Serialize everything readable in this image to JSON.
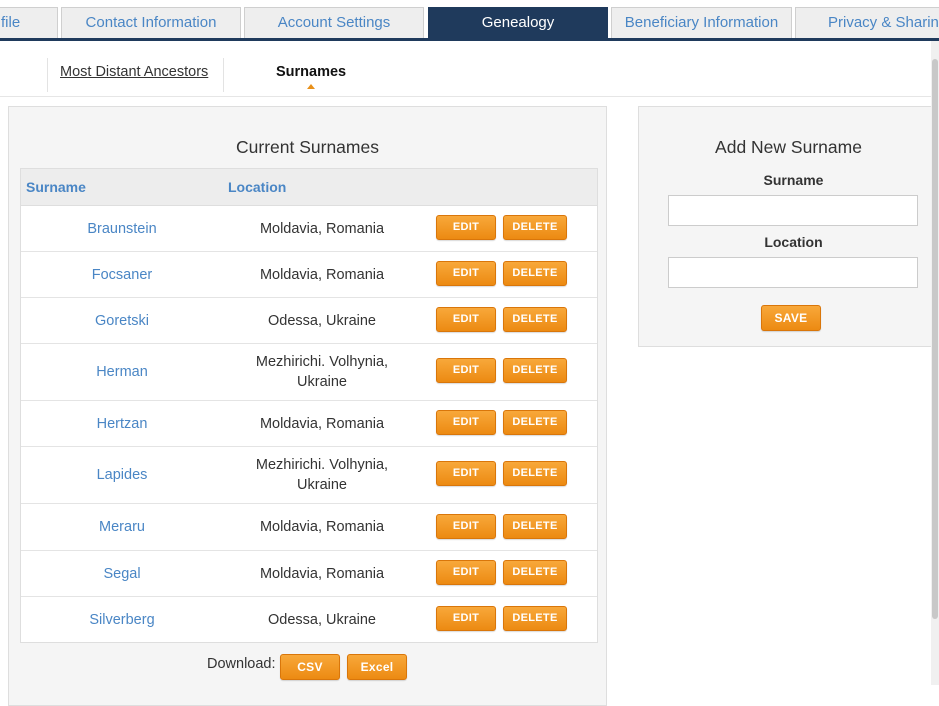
{
  "top_tabs": [
    {
      "label": "file"
    },
    {
      "label": "Contact Information"
    },
    {
      "label": "Account Settings"
    },
    {
      "label": "Genealogy"
    },
    {
      "label": "Beneficiary Information"
    },
    {
      "label": "Privacy & Sharin"
    }
  ],
  "sub_tabs": {
    "ancestors": "Most Distant Ancestors",
    "surnames": "Surnames"
  },
  "surnames_panel": {
    "title": "Current Surnames",
    "columns": {
      "surname": "Surname",
      "location": "Location"
    },
    "edit_label": "EDIT",
    "delete_label": "DELETE",
    "rows": [
      {
        "surname": "Braunstein",
        "location": "Moldavia, Romania"
      },
      {
        "surname": "Focsaner",
        "location": "Moldavia, Romania"
      },
      {
        "surname": "Goretski",
        "location": "Odessa, Ukraine"
      },
      {
        "surname": "Herman",
        "location": "Mezhirichi. Volhynia, Ukraine"
      },
      {
        "surname": "Hertzan",
        "location": "Moldavia, Romania"
      },
      {
        "surname": "Lapides",
        "location": "Mezhirichi. Volhynia, Ukraine"
      },
      {
        "surname": "Meraru",
        "location": "Moldavia, Romania"
      },
      {
        "surname": "Segal",
        "location": "Moldavia, Romania"
      },
      {
        "surname": "Silverberg",
        "location": "Odessa, Ukraine"
      }
    ],
    "download": {
      "label": "Download:",
      "csv": "CSV",
      "excel": "Excel"
    }
  },
  "add_panel": {
    "title": "Add New Surname",
    "surname_label": "Surname",
    "surname_value": "",
    "location_label": "Location",
    "location_value": "",
    "save_label": "SAVE"
  },
  "colors": {
    "active_tab": "#1f3a5c",
    "link_blue": "#4a86c5",
    "button_orange": "#f39a22"
  }
}
